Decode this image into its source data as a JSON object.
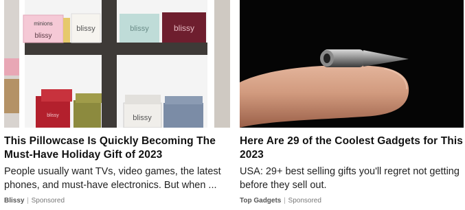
{
  "ads": [
    {
      "headline": "This Pillowcase Is Quickly Becoming The Must-Have Holiday Gift of 2023",
      "description": "People usually want TVs, video games, the latest phones, and must-have electronics. But when ...",
      "brand": "Blissy",
      "separator": "|",
      "sponsored_label": "Sponsored",
      "image_icon": "shelf-of-gift-boxes-image",
      "box_labels": [
        "blissy",
        "blissy",
        "blissy",
        "blissy",
        "blissy",
        "blissy",
        "minions"
      ]
    },
    {
      "headline": "Here Are 29 of the Coolest Gadgets for This 2023",
      "description": "USA: 29+ best selling gifts you'll regret not getting before they sell out.",
      "brand": "Top Gadgets",
      "separator": "|",
      "sponsored_label": "Sponsored",
      "image_icon": "fingertip-with-metal-gadget-image"
    }
  ],
  "colors": {
    "headline": "#111111",
    "source": "#777777"
  }
}
